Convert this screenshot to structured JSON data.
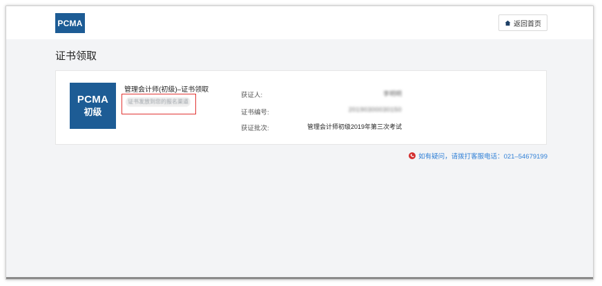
{
  "header": {
    "logo_text": "PCMA",
    "home_button_label": "返回首页",
    "home_icon": "home-icon"
  },
  "page": {
    "title": "证书领取"
  },
  "card": {
    "badge_line1": "PCMA",
    "badge_line2": "初级",
    "course_title": "管理会计师(初级)–证书领取",
    "channel_tag": "证书发放到您的报名渠道",
    "fields": [
      {
        "label": "获证人:",
        "value": "李明明"
      },
      {
        "label": "证书编号:",
        "value": "20190300030150"
      },
      {
        "label": "获证批次:",
        "value": "管理会计师初级2019年第三次考试"
      }
    ]
  },
  "contact": {
    "text": "如有疑问，请拨打客服电话：021–54679199",
    "icon": "phone-icon"
  },
  "colors": {
    "brand": "#1d5c95",
    "highlight_border": "#e0312f",
    "link": "#2f7fd6",
    "background": "#f3f4f6"
  }
}
